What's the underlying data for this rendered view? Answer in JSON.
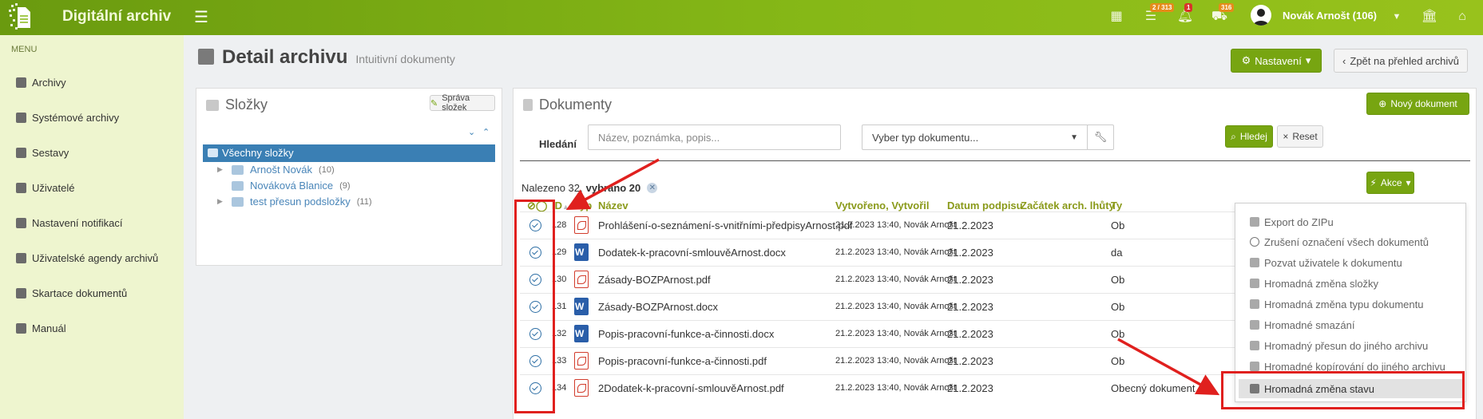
{
  "app": {
    "title": "Digitální archiv",
    "user": "Novák Arnošt (106)",
    "badges": {
      "tasks": "2 / 313",
      "notifications": "1",
      "transport": "316"
    },
    "brand_color": "#86b817"
  },
  "sidebar": {
    "heading": "MENU",
    "items": [
      {
        "label": "Archivy",
        "icon": "archive-icon"
      },
      {
        "label": "Systémové archivy",
        "icon": "server-icon"
      },
      {
        "label": "Sestavy",
        "icon": "book-icon"
      },
      {
        "label": "Uživatelé",
        "icon": "users-icon"
      },
      {
        "label": "Nastavení notifikací",
        "icon": "bell-icon"
      },
      {
        "label": "Uživatelské agendy archivů",
        "icon": "folder-open-icon"
      },
      {
        "label": "Skartace dokumentů",
        "icon": "trash-icon"
      },
      {
        "label": "Manuál",
        "icon": "book-icon"
      }
    ]
  },
  "header": {
    "title": "Detail archivu",
    "subtitle": "Intuitivní dokumenty",
    "settings_label": "Nastavení",
    "back_label": "Zpět na přehled archivů"
  },
  "folders": {
    "title": "Složky",
    "manage_label": "Správa složek",
    "all_label": "Všechny složky",
    "items": [
      {
        "name": "Arnošt Novák",
        "count": "(10)"
      },
      {
        "name": "Nováková Blanice",
        "count": "(9)"
      },
      {
        "name": "test přesun podsložky",
        "count": "(11)"
      }
    ]
  },
  "documents": {
    "title": "Dokumenty",
    "new_label": "Nový dokument",
    "search_label": "Hledání",
    "search_placeholder": "Název, poznámka, popis...",
    "type_placeholder": "Vyber typ dokumentu...",
    "search_button": "Hledej",
    "reset_button": "Reset",
    "found_text": "Nalezeno 32,",
    "selected_text": "vybráno 20",
    "actions_label": "Akce",
    "columns": {
      "id": "ID",
      "type": "Typ",
      "name": "Název",
      "created": "Vytvořeno,",
      "created_by": "Vytvořil",
      "signed": "Datum podpisu",
      "retention": "Začátek arch. lhůty",
      "ty": "Ty"
    },
    "rows": [
      {
        "id": "128",
        "type": "pdf",
        "name": "Prohlášení-o-seznámení-s-vnitřními-předpisyArnost.pdf",
        "created": "21.2.2023 13:40, Novák Arnošt",
        "signed": "21.2.2023",
        "ty": "Ob"
      },
      {
        "id": "129",
        "type": "doc",
        "name": "Dodatek-k-pracovní-smlouvěArnost.docx",
        "created": "21.2.2023 13:40, Novák Arnošt",
        "signed": "21.2.2023",
        "ty": "da"
      },
      {
        "id": "130",
        "type": "pdf",
        "name": "Zásady-BOZPArnost.pdf",
        "created": "21.2.2023 13:40, Novák Arnošt",
        "signed": "21.2.2023",
        "ty": "Ob"
      },
      {
        "id": "131",
        "type": "doc",
        "name": "Zásady-BOZPArnost.docx",
        "created": "21.2.2023 13:40, Novák Arnošt",
        "signed": "21.2.2023",
        "ty": "Ob"
      },
      {
        "id": "132",
        "type": "doc",
        "name": "Popis-pracovní-funkce-a-činnosti.docx",
        "created": "21.2.2023 13:40, Novák Arnošt",
        "signed": "21.2.2023",
        "ty": "Ob"
      },
      {
        "id": "133",
        "type": "pdf",
        "name": "Popis-pracovní-funkce-a-činnosti.pdf",
        "created": "21.2.2023 13:40, Novák Arnošt",
        "signed": "21.2.2023",
        "ty": "Ob"
      },
      {
        "id": "134",
        "type": "pdf",
        "name": "2Dodatek-k-pracovní-smlouvěArnost.pdf",
        "created": "21.2.2023 13:40, Novák Arnošt",
        "signed": "21.2.2023",
        "ty": "Obecný dokument"
      }
    ]
  },
  "actions_menu": [
    {
      "label": "Export do ZIPu",
      "icon": "archive-icon"
    },
    {
      "label": "Zrušení označení všech dokumentů",
      "icon": "circle-icon"
    },
    {
      "label": "Pozvat uživatele k dokumentu",
      "icon": "user-icon"
    },
    {
      "label": "Hromadná změna složky",
      "icon": "folder-icon"
    },
    {
      "label": "Hromadná změna typu dokumentu",
      "icon": "list-icon"
    },
    {
      "label": "Hromadné smazání",
      "icon": "trash-icon"
    },
    {
      "label": "Hromadný přesun do jiného archivu",
      "icon": "move-icon"
    },
    {
      "label": "Hromadné kopírování do jiného archivu",
      "icon": "copy-icon"
    },
    {
      "label": "Hromadná změna stavu",
      "icon": "archive-icon"
    }
  ]
}
